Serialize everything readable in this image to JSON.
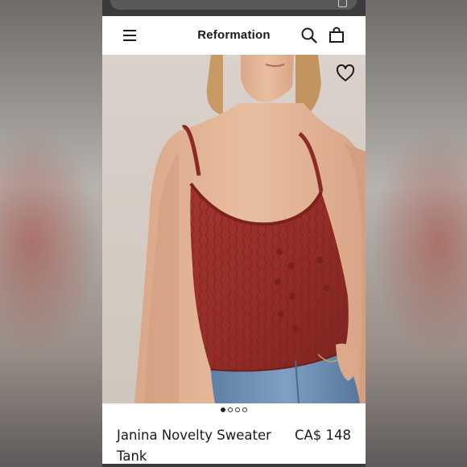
{
  "header": {
    "brand": "Reformation",
    "menu_icon": "hamburger-menu-icon",
    "search_icon": "search-icon",
    "bag_icon": "shopping-bag-icon"
  },
  "browser": {
    "tabs_icon": "tabs-icon"
  },
  "product": {
    "name": "Janina Novelty Sweater Tank",
    "price": "CA$ 148",
    "wishlist_icon": "heart-icon",
    "image_count": 4,
    "active_image": 1
  },
  "colors": {
    "sweater": "#9a2f2a",
    "background": "#dcd3cb",
    "text": "#1a1a1a"
  }
}
